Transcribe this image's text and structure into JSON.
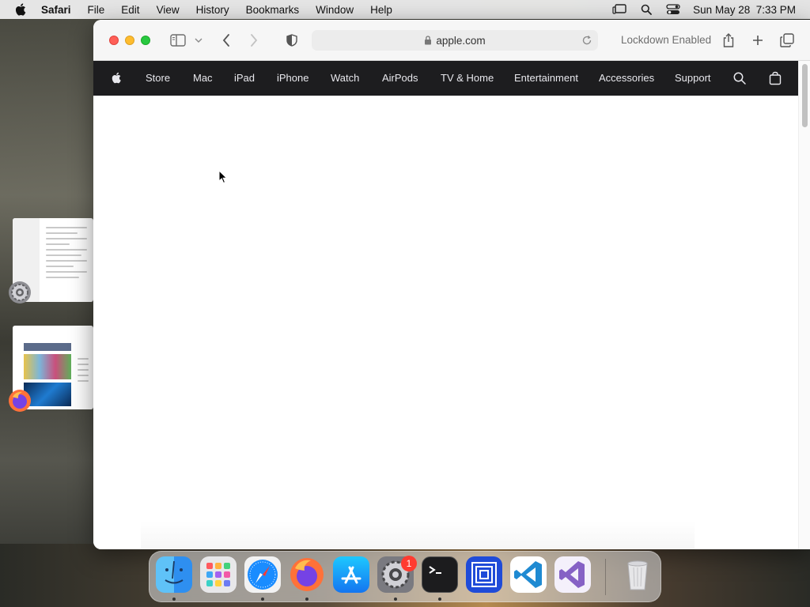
{
  "menubar": {
    "app_name": "Safari",
    "items": [
      "File",
      "Edit",
      "View",
      "History",
      "Bookmarks",
      "Window",
      "Help"
    ],
    "datetime": "Sun May 28  7:33 PM"
  },
  "safari": {
    "address": "apple.com",
    "lockdown_label": "Lockdown Enabled"
  },
  "globalnav": {
    "links": [
      "Store",
      "Mac",
      "iPad",
      "iPhone",
      "Watch",
      "AirPods",
      "TV & Home",
      "Entertainment",
      "Accessories",
      "Support"
    ]
  },
  "dock": {
    "badge_count": "1",
    "apps": [
      "Finder",
      "Launchpad",
      "Safari",
      "Firefox",
      "App Store",
      "System Settings",
      "Terminal",
      "Screen Sharing",
      "Visual Studio Code",
      "Visual Studio",
      "Trash"
    ]
  },
  "colors": {
    "nav_bg": "#1d1d1f",
    "close": "#ff5f57",
    "minimize": "#febc2e",
    "maximize": "#28c840"
  }
}
